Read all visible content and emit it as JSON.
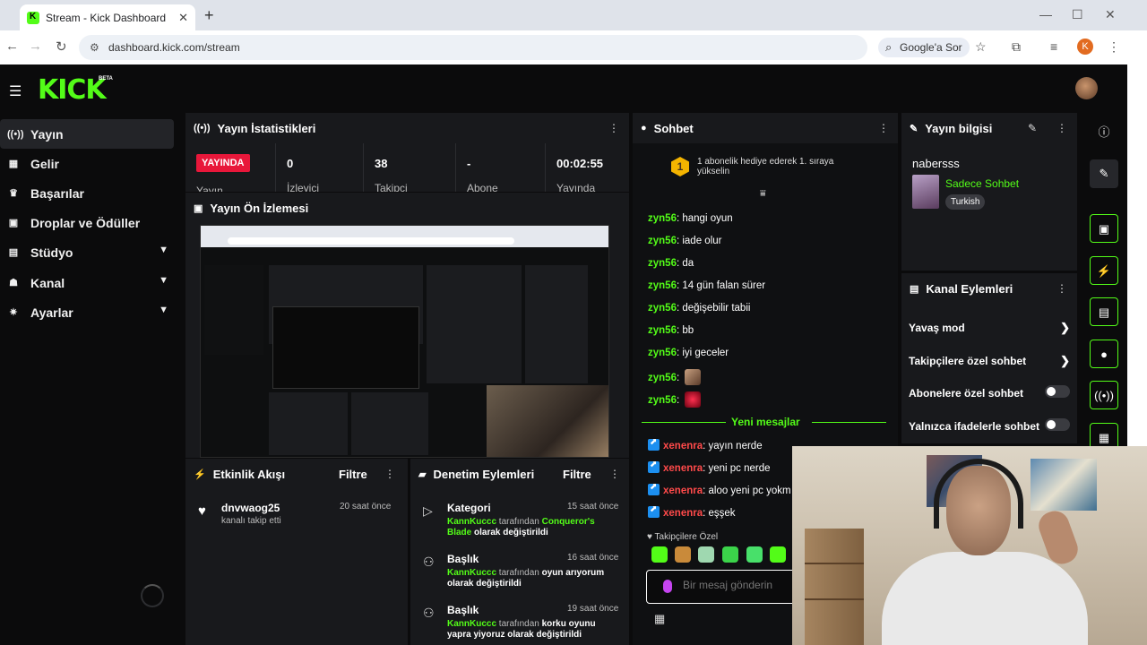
{
  "browser": {
    "tab_title": "Stream - Kick Dashboard",
    "url": "dashboard.kick.com/stream",
    "google_ask": "Google'a Sor",
    "profile_initial": "K"
  },
  "brand": {
    "logo": "KICK",
    "badge": "BETA",
    "accent": "#53fc18"
  },
  "sidebar": {
    "items": [
      {
        "label": "Yayın",
        "icon": "broadcast-icon"
      },
      {
        "label": "Gelir",
        "icon": "revenue-icon"
      },
      {
        "label": "Başarılar",
        "icon": "trophy-icon"
      },
      {
        "label": "Droplar ve Ödüller",
        "icon": "drops-icon"
      },
      {
        "label": "Stüdyo",
        "icon": "studio-icon"
      },
      {
        "label": "Kanal",
        "icon": "channel-icon"
      },
      {
        "label": "Ayarlar",
        "icon": "gear-icon"
      }
    ]
  },
  "stats": {
    "title": "Yayın İstatistikleri",
    "live_badge": "YAYINDA",
    "live_label": "Yayın",
    "cells": [
      {
        "value": "0",
        "label": "İzleyici"
      },
      {
        "value": "38",
        "label": "Takipçi"
      },
      {
        "value": "-",
        "label": "Abone"
      },
      {
        "value": "00:02:55",
        "label": "Yayında"
      }
    ]
  },
  "preview": {
    "title": "Yayın Ön İzlemesi"
  },
  "activity": {
    "title": "Etkinlik Akışı",
    "filter": "Filtre",
    "items": [
      {
        "user": "dnvwaog25",
        "action": "kanalı takip etti",
        "time": "20 saat önce"
      }
    ]
  },
  "modlog": {
    "title": "Denetim Eylemleri",
    "filter": "Filtre",
    "items": [
      {
        "title": "Kategori",
        "time": "15 saat önce",
        "user": "KannKuccc",
        "mid": "tarafından",
        "value": "Conqueror's Blade",
        "end": "olarak değiştirildi"
      },
      {
        "title": "Başlık",
        "time": "16 saat önce",
        "user": "KannKuccc",
        "mid": "tarafından",
        "value": "oyun arıyorum",
        "end": "olarak değiştirildi"
      },
      {
        "title": "Başlık",
        "time": "19 saat önce",
        "user": "KannKuccc",
        "mid": "tarafından",
        "value": "korku oyunu",
        "end": "yapra yiyoruz olarak değiştirildi"
      }
    ]
  },
  "chat": {
    "title": "Sohbet",
    "goal": "1 abonelik hediye ederek 1. sıraya yükselin",
    "goal_rank": "1",
    "messages": [
      {
        "user": "zyn56",
        "text": "hangi oyun"
      },
      {
        "user": "zyn56",
        "text": "iade olur"
      },
      {
        "user": "zyn56",
        "text": "da"
      },
      {
        "user": "zyn56",
        "text": "14 gün falan sürer"
      },
      {
        "user": "zyn56",
        "text": "değişebilir tabii"
      },
      {
        "user": "zyn56",
        "text": "bb"
      },
      {
        "user": "zyn56",
        "text": "iyi geceler"
      },
      {
        "user": "zyn56",
        "text": ""
      },
      {
        "user": "zyn56",
        "text": ""
      }
    ],
    "new_messages": "Yeni mesajlar",
    "new": [
      {
        "user": "xenenra",
        "text": "yayın nerde"
      },
      {
        "user": "xenenra",
        "text": "yeni pc nerde"
      },
      {
        "user": "xenenra",
        "text": "aloo yeni pc yokm"
      },
      {
        "user": "xenenra",
        "text": "eşşek"
      }
    ],
    "followers_only": "Takipçilere Özel",
    "input_placeholder": "Bir mesaj gönderin"
  },
  "info": {
    "title": "Yayın bilgisi",
    "username": "nabersss",
    "category": "Sadece Sohbet",
    "language": "Turkish"
  },
  "channel_actions": {
    "title": "Kanal Eylemleri",
    "items": [
      {
        "label": "Yavaş mod",
        "kind": "arrow"
      },
      {
        "label": "Takipçilere özel sohbet",
        "kind": "arrow"
      },
      {
        "label": "Abonelere özel sohbet",
        "kind": "toggle",
        "on": false
      },
      {
        "label": "Yalnızca ifadelerle sohbet",
        "kind": "toggle",
        "on": false
      }
    ]
  }
}
